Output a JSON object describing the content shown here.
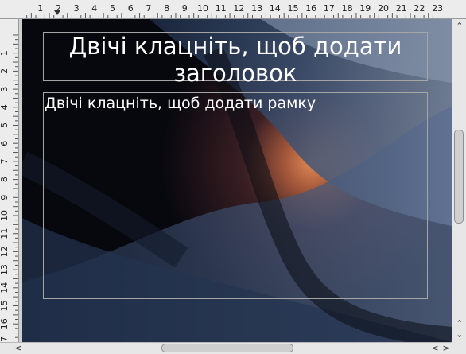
{
  "ruler": {
    "horizontal_labels": [
      "1",
      "2",
      "3",
      "4",
      "5",
      "6",
      "7",
      "8",
      "9",
      "10",
      "11",
      "12",
      "13",
      "14",
      "15",
      "16",
      "17",
      "18",
      "19",
      "20",
      "21",
      "22",
      "23"
    ],
    "vertical_labels": [
      "1",
      "2",
      "3",
      "4",
      "5",
      "6",
      "7",
      "8",
      "9",
      "10",
      "11",
      "12",
      "13",
      "14",
      "15",
      "16",
      "17"
    ]
  },
  "slide": {
    "title_placeholder": "Двічі клацніть, щоб додати заголовок",
    "body_placeholder": "Двічі клацніть, щоб додати рамку"
  },
  "scrollbars": {
    "up_arrow": "⌃",
    "down_arrow": "⌄",
    "left_arrow": "<",
    "right_arrow": ">"
  },
  "colors": {
    "slide_dark": "#0f1624",
    "accent_orange": "#d97a4a",
    "placeholder_border": "#a5a5a5"
  }
}
